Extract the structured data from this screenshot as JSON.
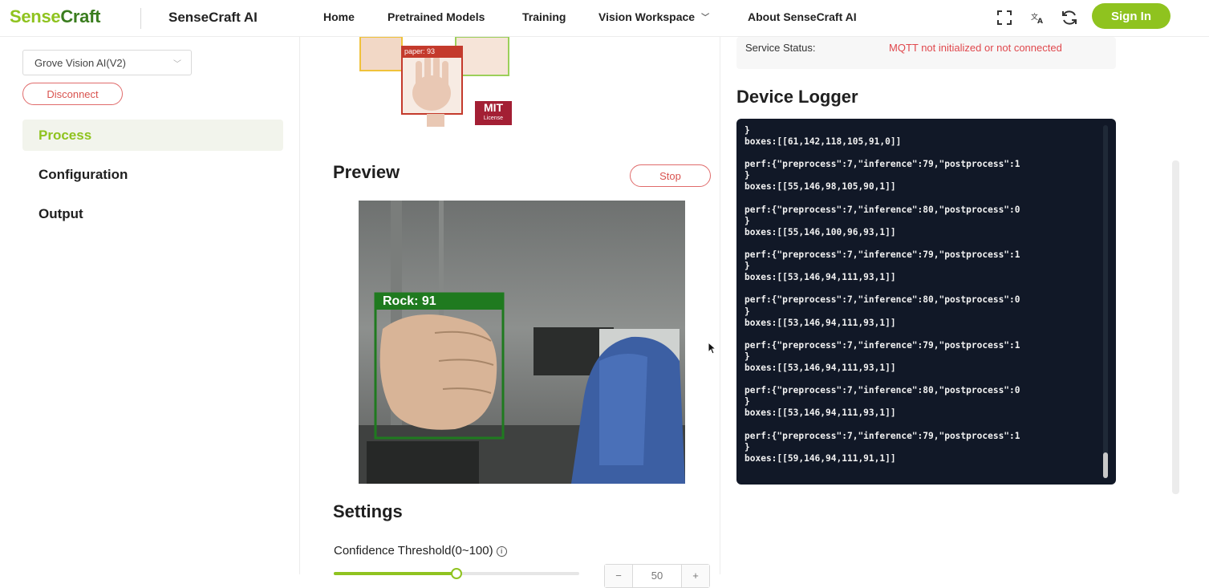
{
  "brand": {
    "logo_sense": "Sense",
    "logo_craft": "Craft",
    "app_title": "SenseCraft AI"
  },
  "nav": {
    "items": [
      "Home",
      "Pretrained Models",
      "Training",
      "Vision Workspace",
      "About SenseCraft AI"
    ],
    "signin": "Sign In",
    "icons": [
      "fullscreen-icon",
      "translate-icon",
      "refresh-icon"
    ]
  },
  "sidebar": {
    "device": "Grove Vision AI(V2)",
    "disconnect": "Disconnect",
    "items": [
      {
        "label": "Process",
        "active": true
      },
      {
        "label": "Configuration",
        "active": false
      },
      {
        "label": "Output",
        "active": false
      }
    ]
  },
  "middle": {
    "sample_label": "paper: 93",
    "sample_badge": "MIT",
    "sample_badge_sub": "License",
    "preview_title": "Preview",
    "stop": "Stop",
    "detection_label": "Rock: 91",
    "settings_title": "Settings",
    "confidence_label": "Confidence Threshold(0~100)",
    "confidence_value": 50,
    "stepper_minus": "−",
    "stepper_plus": "+"
  },
  "right": {
    "service_status_label": "Service Status:",
    "service_status_value": "MQTT not initialized or not connected",
    "logger_title": "Device Logger",
    "log_lines": [
      "}",
      "boxes:[[61,142,118,105,91,0]]",
      "",
      "perf:{\"preprocess\":7,\"inference\":79,\"postprocess\":1",
      "}",
      "boxes:[[55,146,98,105,90,1]]",
      "",
      "perf:{\"preprocess\":7,\"inference\":80,\"postprocess\":0",
      "}",
      "boxes:[[55,146,100,96,93,1]]",
      "",
      "perf:{\"preprocess\":7,\"inference\":79,\"postprocess\":1",
      "}",
      "boxes:[[53,146,94,111,93,1]]",
      "",
      "perf:{\"preprocess\":7,\"inference\":80,\"postprocess\":0",
      "}",
      "boxes:[[53,146,94,111,93,1]]",
      "",
      "perf:{\"preprocess\":7,\"inference\":79,\"postprocess\":1",
      "}",
      "boxes:[[53,146,94,111,93,1]]",
      "",
      "perf:{\"preprocess\":7,\"inference\":80,\"postprocess\":0",
      "}",
      "boxes:[[53,146,94,111,93,1]]",
      "",
      "perf:{\"preprocess\":7,\"inference\":79,\"postprocess\":1",
      "}",
      "boxes:[[59,146,94,111,91,1]]"
    ]
  },
  "colors": {
    "brand_green": "#8fc31f",
    "danger": "#d9534f",
    "logger_bg": "#111827"
  }
}
